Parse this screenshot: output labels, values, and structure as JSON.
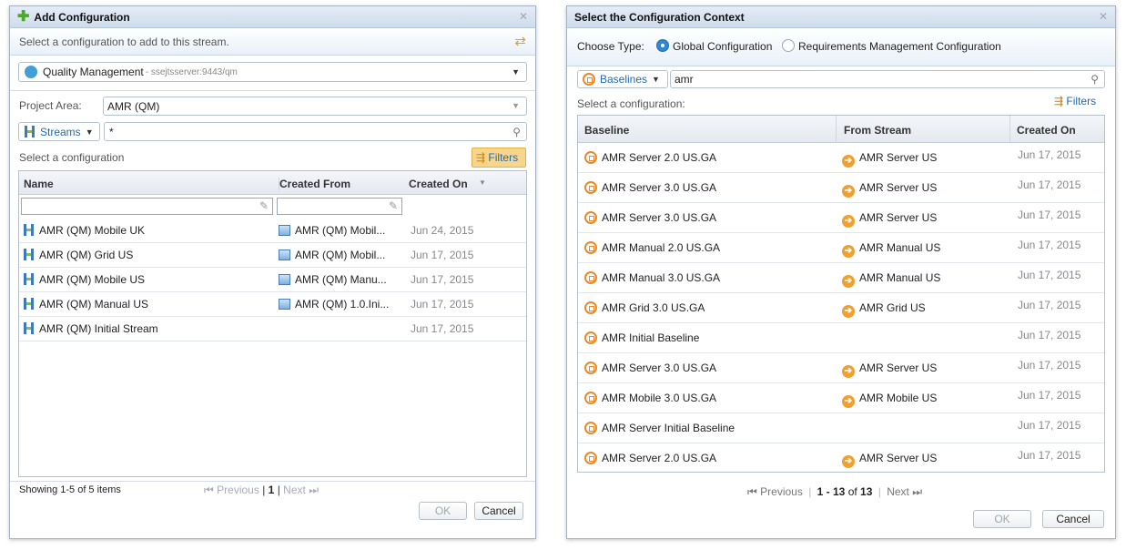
{
  "add_config": {
    "title": "Add Configuration",
    "subtitle": "Select a configuration to add to this stream.",
    "source_name": "Quality Management",
    "source_host": " - ssejtsserver:9443/qm",
    "project_area_label": "Project Area:",
    "project_area_value": "AMR (QM)",
    "type_select": "Streams",
    "search_value": "*",
    "select_label": "Select a configuration",
    "filters_label": "Filters",
    "columns": [
      "Name",
      "Created From",
      "Created On"
    ],
    "rows": [
      {
        "name": "AMR (QM) Mobile UK",
        "from": "AMR (QM) Mobil...",
        "date": "Jun 24, 2015"
      },
      {
        "name": "AMR (QM) Grid US",
        "from": "AMR (QM) Mobil...",
        "date": "Jun 17, 2015"
      },
      {
        "name": "AMR (QM) Mobile US",
        "from": "AMR (QM) Manu...",
        "date": "Jun 17, 2015"
      },
      {
        "name": "AMR (QM) Manual US",
        "from": "AMR (QM) 1.0.Ini...",
        "date": "Jun 17, 2015"
      },
      {
        "name": "AMR (QM) Initial Stream",
        "from": "",
        "date": "Jun 17, 2015"
      }
    ],
    "showing": "Showing 1-5 of 5 items",
    "prev": "Previous",
    "page": "1",
    "next": "Next",
    "ok": "OK",
    "cancel": "Cancel"
  },
  "select_context": {
    "title": "Select the Configuration Context",
    "choose_type_label": "Choose Type:",
    "radio_global": "Global Configuration",
    "radio_rm": "Requirements Management Configuration",
    "type_select": "Baselines",
    "search_value": "amr",
    "select_label": "Select a configuration:",
    "filters_label": "Filters",
    "columns": [
      "Baseline",
      "From Stream",
      "Created On"
    ],
    "rows": [
      {
        "baseline": "AMR Server 2.0 US.GA",
        "stream": "AMR Server US",
        "date": "Jun 17, 2015"
      },
      {
        "baseline": "AMR Server 3.0 US.GA",
        "stream": "AMR Server US",
        "date": "Jun 17, 2015"
      },
      {
        "baseline": "AMR Server 3.0 US.GA",
        "stream": "AMR Server US",
        "date": "Jun 17, 2015"
      },
      {
        "baseline": "AMR Manual 2.0 US.GA",
        "stream": "AMR Manual US",
        "date": "Jun 17, 2015"
      },
      {
        "baseline": "AMR Manual 3.0 US.GA",
        "stream": "AMR Manual US",
        "date": "Jun 17, 2015"
      },
      {
        "baseline": "AMR Grid 3.0 US.GA",
        "stream": "AMR Grid US",
        "date": "Jun 17, 2015"
      },
      {
        "baseline": "AMR Initial Baseline",
        "stream": "",
        "date": "Jun 17, 2015"
      },
      {
        "baseline": "AMR Server 3.0 US.GA",
        "stream": "AMR Server US",
        "date": "Jun 17, 2015"
      },
      {
        "baseline": "AMR Mobile 3.0 US.GA",
        "stream": "AMR Mobile US",
        "date": "Jun 17, 2015"
      },
      {
        "baseline": "AMR Server Initial Baseline",
        "stream": "",
        "date": "Jun 17, 2015"
      },
      {
        "baseline": "AMR Server 2.0 US.GA",
        "stream": "AMR Server US",
        "date": "Jun 17, 2015"
      }
    ],
    "prev": "Previous",
    "range": "1 - 13",
    "of_label": "of",
    "total": "13",
    "next": "Next",
    "ok": "OK",
    "cancel": "Cancel"
  }
}
